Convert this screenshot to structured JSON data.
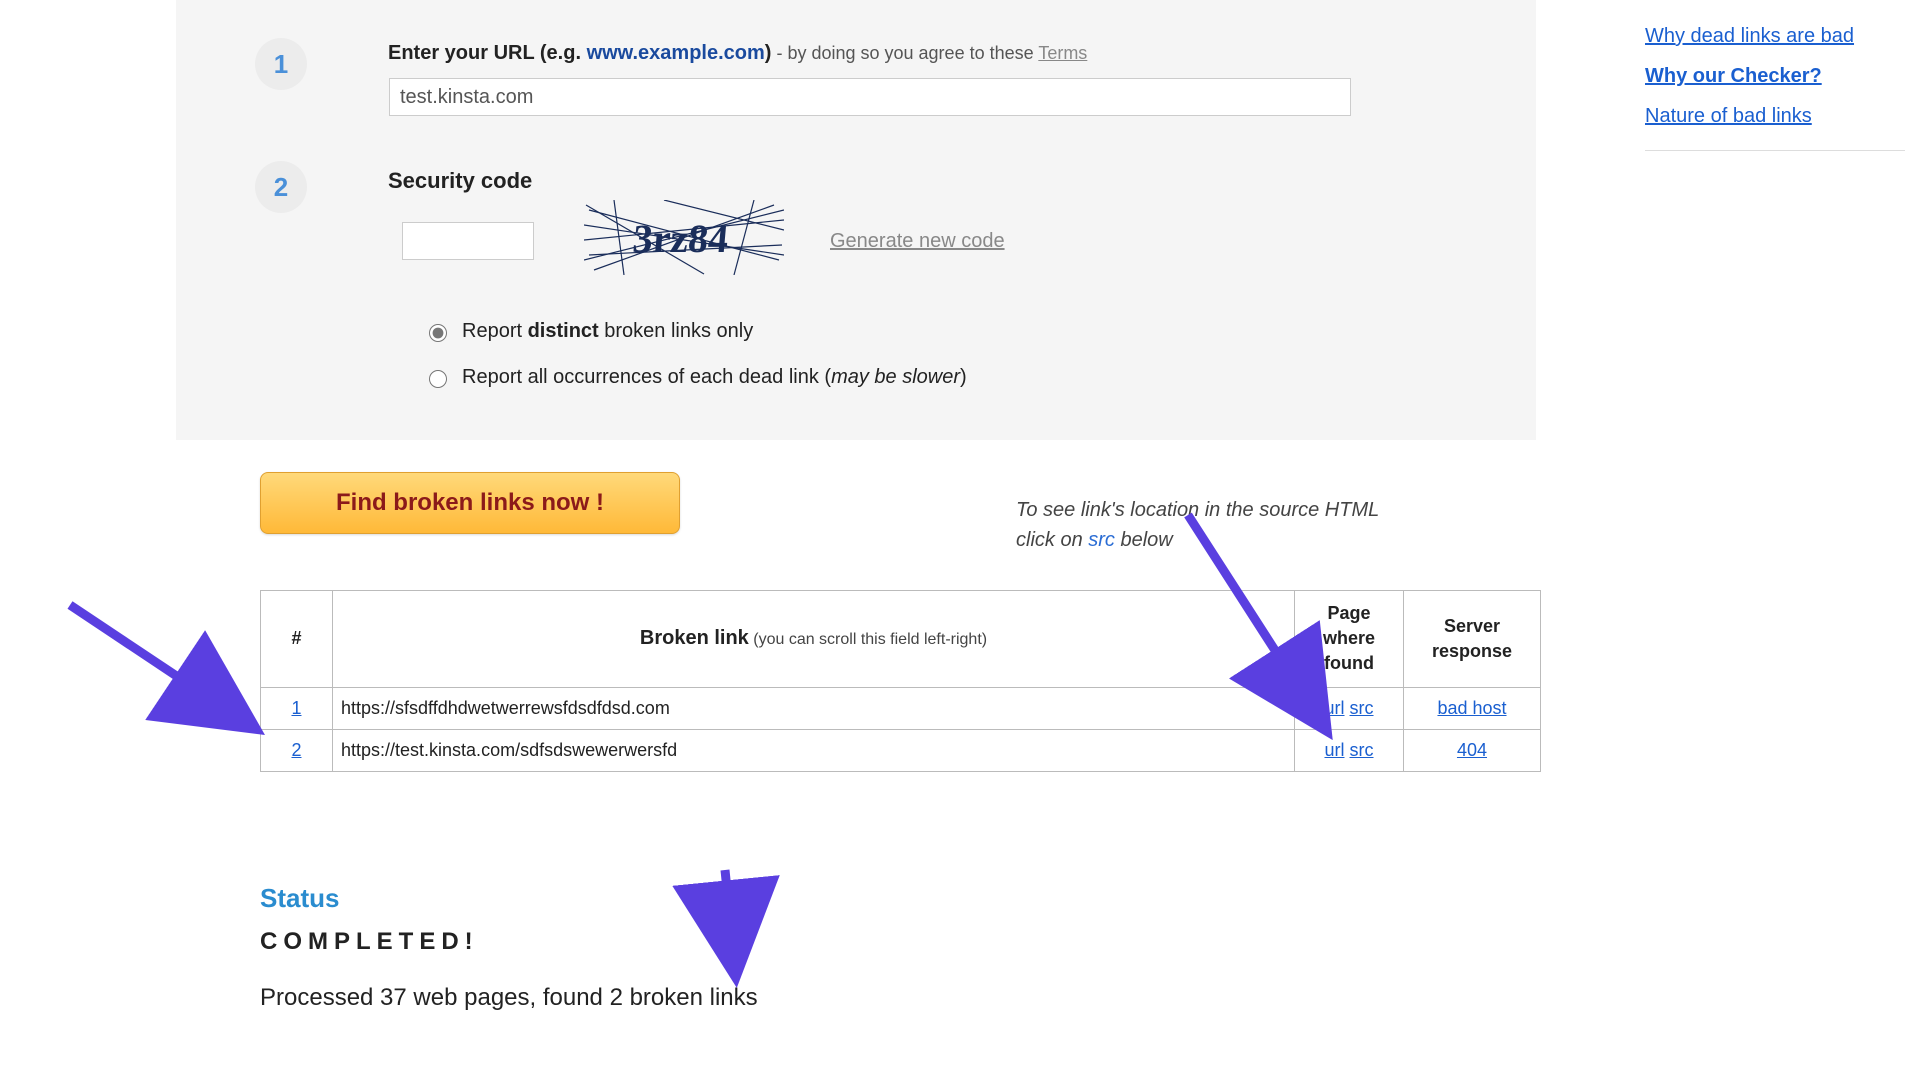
{
  "steps": {
    "s1": "1",
    "s2": "2",
    "url_label_main": "Enter your URL",
    "url_label_example_paren_open": " (e.g. ",
    "url_label_example": "www.example.com",
    "url_label_example_paren_close": ")",
    "url_hint": " - by doing so you agree to these ",
    "url_terms": "Terms",
    "url_value": "test.kinsta.com",
    "security_label": "Security code",
    "captcha_text": "3rz84",
    "generate_label": "Generate new code",
    "radio1_pre": "Report ",
    "radio1_bold": "distinct",
    "radio1_post": " broken links only",
    "radio2_pre": "Report all occurrences of each dead link (",
    "radio2_ital": "may be slower",
    "radio2_post": ")"
  },
  "find_button": "Find broken links now !",
  "src_hint": {
    "line1": "To see link's location in the source HTML",
    "line2a": "click on ",
    "line2b": "src",
    "line2c": " below"
  },
  "table": {
    "hdr_num": "#",
    "hdr_bl": "Broken link",
    "hdr_bl_sub": " (you can scroll this field left-right)",
    "hdr_pwf": "Page where found",
    "hdr_resp": "Server response",
    "url_label": "url",
    "src_label": "src",
    "rows": [
      {
        "n": "1",
        "link": "https://sfsdffdhdwetwerrewsfdsdfdsd.com",
        "resp": "bad host"
      },
      {
        "n": "2",
        "link": "https://test.kinsta.com/sdfsdswewerwersfd",
        "resp": "404"
      }
    ]
  },
  "status": {
    "header": "Status",
    "completed": "COMPLETED!",
    "message": "Processed 37 web pages, found 2 broken links"
  },
  "sidebar": {
    "links": [
      {
        "label": "Why dead links are bad",
        "active": false
      },
      {
        "label": "Why our Checker?",
        "active": true
      },
      {
        "label": "Nature of bad links",
        "active": false
      }
    ]
  }
}
